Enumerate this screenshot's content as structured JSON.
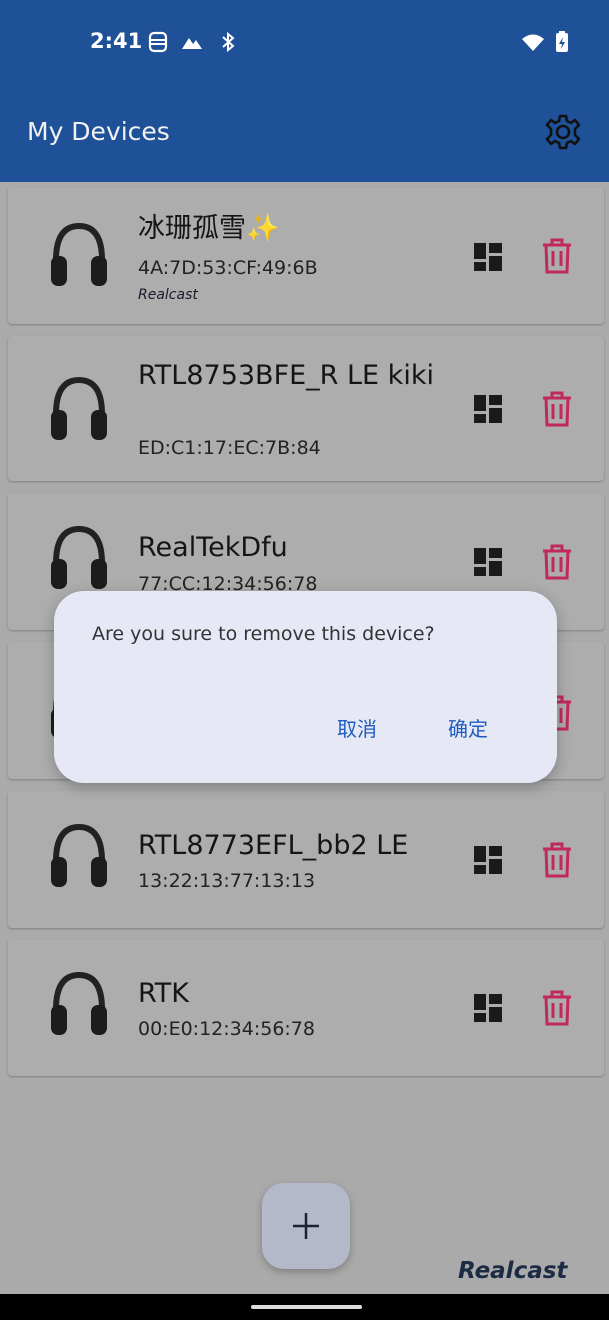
{
  "status_bar": {
    "time": "2:41",
    "icons": [
      "sim-icon",
      "signal-triangle-icon",
      "bluetooth-icon",
      "wifi-icon",
      "battery-icon"
    ]
  },
  "toolbar": {
    "title": "My Devices",
    "settings_icon": "gear-icon"
  },
  "devices": [
    {
      "name": "冰珊孤雪✨",
      "mac": "4A:7D:53:CF:49:6B",
      "brand": "Realcast"
    },
    {
      "name": "RTL8753BFE_R LE kiki",
      "mac": "ED:C1:17:EC:7B:84"
    },
    {
      "name": "RealTekDfu",
      "mac": "77:CC:12:34:56:78"
    },
    {
      "name": "",
      "mac": ""
    },
    {
      "name": "RTL8773EFL_bb2 LE",
      "mac": "13:22:13:77:13:13"
    },
    {
      "name": "RTK",
      "mac": "00:E0:12:34:56:78"
    }
  ],
  "dialog": {
    "message": "Are you sure to remove this device?",
    "cancel_label": "取消",
    "confirm_label": "确定"
  },
  "fab": {
    "icon": "plus-icon"
  },
  "footer": {
    "brand": "Realcast"
  },
  "colors": {
    "toolbar": "#1f5199",
    "delete": "#c2295b",
    "dialog_bg": "#e6e8f6",
    "dialog_button": "#1e5cbf"
  }
}
